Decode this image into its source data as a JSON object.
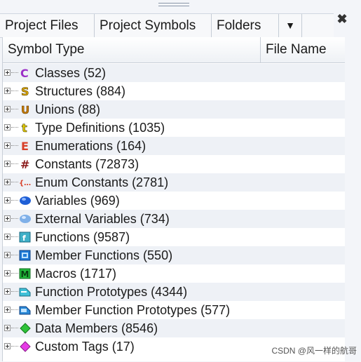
{
  "tabs": {
    "project_files": "Project Files",
    "project_symbols": "Project Symbols",
    "folders": "Folders",
    "more_glyph": "▼"
  },
  "close_glyph": "✖",
  "columns": {
    "symbol_type": "Symbol Type",
    "file_name": "File Name"
  },
  "rows": [
    {
      "label": "Classes (52)",
      "icon": "class-icon"
    },
    {
      "label": "Structures (884)",
      "icon": "struct-icon"
    },
    {
      "label": "Unions (88)",
      "icon": "union-icon"
    },
    {
      "label": "Type Definitions (1035)",
      "icon": "typedef-icon"
    },
    {
      "label": "Enumerations (164)",
      "icon": "enum-icon"
    },
    {
      "label": "Constants (72873)",
      "icon": "constant-icon"
    },
    {
      "label": "Enum Constants (2781)",
      "icon": "enum-constant-icon"
    },
    {
      "label": "Variables (969)",
      "icon": "variable-icon"
    },
    {
      "label": "External Variables (734)",
      "icon": "external-variable-icon"
    },
    {
      "label": "Functions (9587)",
      "icon": "function-icon"
    },
    {
      "label": "Member Functions (550)",
      "icon": "member-function-icon"
    },
    {
      "label": "Macros (1717)",
      "icon": "macro-icon"
    },
    {
      "label": "Function Prototypes (4344)",
      "icon": "function-prototype-icon"
    },
    {
      "label": "Member Function Prototypes (577)",
      "icon": "member-function-prototype-icon"
    },
    {
      "label": "Data Members (8546)",
      "icon": "data-member-icon"
    },
    {
      "label": "Custom Tags (17)",
      "icon": "custom-tag-icon"
    }
  ],
  "watermark": "CSDN @风一样的航哥"
}
